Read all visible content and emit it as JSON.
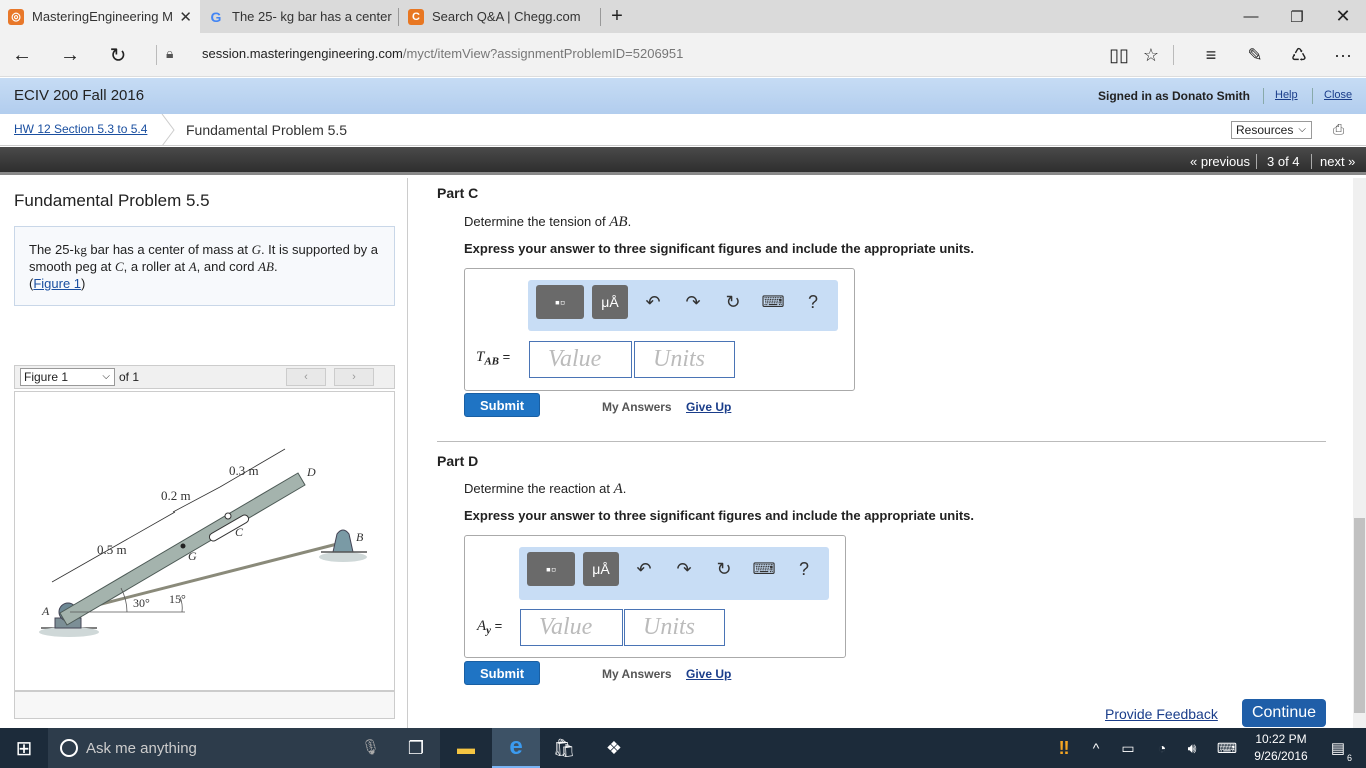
{
  "browser": {
    "tabs": [
      {
        "title": "MasteringEngineering M",
        "icon": "mastering-icon"
      },
      {
        "title": "The 25- kg bar has a center",
        "icon": "google-icon"
      },
      {
        "title": "Search Q&A | Chegg.com",
        "icon": "chegg-icon"
      }
    ],
    "url_host": "session.masteringengineering.com",
    "url_path": "/myct/itemView?assignmentProblemID=5206951"
  },
  "header": {
    "course": "ECIV 200 Fall 2016",
    "signed_in": "Signed in as Donato Smith",
    "help": "Help",
    "close": "Close"
  },
  "breadcrumb": {
    "assignment": "HW 12 Section 5.3 to 5.4",
    "problem": "Fundamental Problem 5.5",
    "resources": "Resources"
  },
  "nav": {
    "previous": "« previous",
    "position": "3 of 4",
    "next": "next »"
  },
  "problem": {
    "title": "Fundamental Problem 5.5",
    "text_1": "The 25-",
    "text_kg": "kg",
    "text_2": " bar has a center of mass at ",
    "text_G": "G",
    "text_3": ". It is supported by a smooth peg at ",
    "text_C": "C",
    "text_4": ", a roller at ",
    "text_A": "A",
    "text_5": ", and cord ",
    "text_AB": "AB",
    "text_6": ".",
    "figure_link": "Figure 1",
    "figure_select": "Figure 1",
    "figure_of": "of 1"
  },
  "figure": {
    "dim_03": "0.3 m",
    "dim_02": "0.2 m",
    "dim_05": "0.5 m",
    "label_D": "D",
    "label_C": "C",
    "label_G": "G",
    "label_B": "B",
    "label_A": "A",
    "angle_30": "30°",
    "angle_15": "15°"
  },
  "partC": {
    "title": "Part C",
    "prompt_pre": "Determine the tension of ",
    "prompt_var": "AB",
    "prompt_post": ".",
    "instruction": "Express your answer to three significant figures and include the appropriate units.",
    "var_main": "T",
    "var_sub": "AB",
    "equals": " =",
    "value_placeholder": "Value",
    "units_placeholder": "Units",
    "submit": "Submit",
    "my_answers": "My Answers",
    "give_up": "Give Up"
  },
  "partD": {
    "title": "Part D",
    "prompt_pre": "Determine the reaction at ",
    "prompt_var": "A",
    "prompt_post": ".",
    "instruction": "Express your answer to three significant figures and include the appropriate units.",
    "var_main": "A",
    "var_sub": "y",
    "equals": " =",
    "value_placeholder": "Value",
    "units_placeholder": "Units",
    "submit": "Submit",
    "my_answers": "My Answers",
    "give_up": "Give Up"
  },
  "toolbar": {
    "units_glyph": "μÅ",
    "help": "?"
  },
  "footer": {
    "feedback": "Provide Feedback",
    "continue": "Continue"
  },
  "taskbar": {
    "search": "Ask me anything",
    "time": "10:22 PM",
    "date": "9/26/2016",
    "notifications": "6"
  }
}
